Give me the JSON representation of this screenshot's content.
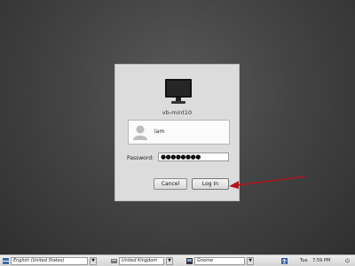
{
  "login": {
    "hostname": "vb-mint10",
    "username": "lam",
    "password_label": "Password:",
    "password_mask": "●●●●●●●●",
    "cancel_label": "Cancel",
    "login_label": "Log In"
  },
  "taskbar": {
    "language_value": "English (United States)",
    "keyboard_value": "United Kingdom",
    "session_value": "Gnome",
    "dropdown_glyph": "▼",
    "day": "Tue",
    "time": "7:59 PM",
    "power_glyph": "⏻"
  },
  "colors": {
    "arrow": "#b0161c"
  }
}
